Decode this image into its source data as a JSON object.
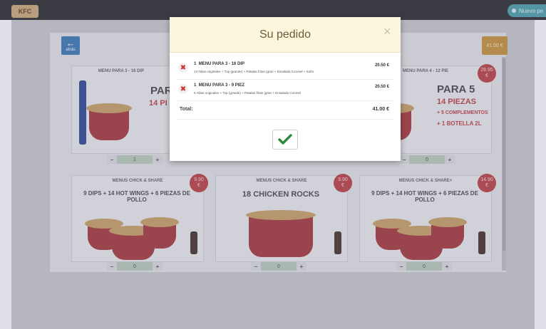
{
  "topbar": {
    "brand_tag": "KFC",
    "nuevo_label": "Nuevo pe"
  },
  "page": {
    "back_label": "atrás",
    "total_label": "41.00 €"
  },
  "cards": [
    {
      "title": "MENU PARA 3 - 16 DIP",
      "promo": "PAR",
      "promo_sub": "14 PI",
      "qty": "1"
    },
    {
      "title": "MENU PARA 4 - 12 PIE",
      "promo": "PARA 5",
      "promo_sub": "14 PIEZAS",
      "promo_sub2": "+ 5 COMPLEMENTOS",
      "promo_sub3": "+ 1 BOTELLA 2L",
      "price": "28.95",
      "qty": "0"
    },
    {
      "title": "MENUS CHICK & SHARE",
      "promo": "9 DIPS + 14 HOT WINGS + 6 PIEZAS DE POLLO",
      "price": "9.90",
      "qty": "0"
    },
    {
      "title": "MENUS CHICK & SHARE",
      "promo": "18 CHICKEN ROCKS",
      "price": "9.90",
      "qty": "0"
    },
    {
      "title": "MENUS CHICK & SHARE+",
      "promo": "9 DIPS + 14 HOT WINGS + 6 PIEZAS DE POLLO",
      "price": "14.90",
      "qty": "0"
    }
  ],
  "currency": "€",
  "modal": {
    "title": "Su pedido",
    "close": "×",
    "items": [
      {
        "qty": "1",
        "name": "MENU PARA 3 - 16 DIP",
        "desc": "14 Alitas originales + Tup (grande) + Patatas fritas (gran + Ensalada Coronel + Sofre",
        "price": "20.50 €"
      },
      {
        "qty": "1",
        "name": "MENU PARA 3 - 9 PIEZ",
        "desc": "9 Alitas originales + Tup (grande) + Patatas fritas (gran + Ensalada Coronel",
        "price": "20.50 €"
      }
    ],
    "total_label": "Total:",
    "total_value": "41.00 €"
  },
  "colors": {
    "accent": "#2e8b3e",
    "remove": "#c9302c",
    "price_badge": "#b83232"
  }
}
